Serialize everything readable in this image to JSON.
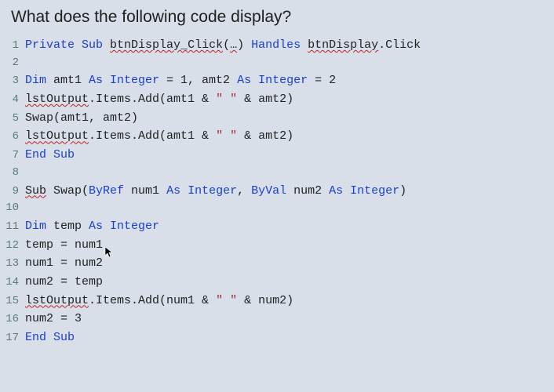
{
  "question": "What does the following code display?",
  "lines": {
    "l1": {
      "kw1": "Private Sub",
      "p1": " ",
      "sq1": "btnDisplay_Click",
      "p2": "(",
      "sq2": "…",
      "p3": ") ",
      "kw2": "Handles",
      "p4": " ",
      "sq3": "btnDisplay",
      "p5": ".Click"
    },
    "l3": {
      "kw1": "Dim",
      "p1": " amt1 ",
      "kw2": "As Integer",
      "p2": " = 1, amt2 ",
      "kw3": "As Integer",
      "p3": " = 2"
    },
    "l4": {
      "sq1": "lstOutput",
      "p1": ".Items.Add(amt1 ",
      "amp1": "&",
      "p2": " ",
      "str1": "\" \"",
      "p3": " ",
      "amp2": "&",
      "p4": " amt2)"
    },
    "l5": {
      "p1": "Swap(amt1, amt2)"
    },
    "l6": {
      "sq1": "lstOutput",
      "p1": ".Items.Add(amt1 ",
      "amp1": "&",
      "p2": " ",
      "str1": "\" \"",
      "p3": " ",
      "amp2": "&",
      "p4": " amt2)"
    },
    "l7": {
      "kw1": "End Sub"
    },
    "l9": {
      "sq1": "Sub",
      "p1": " Swap(",
      "kw1": "ByRef",
      "p2": " num1 ",
      "kw2": "As Integer",
      "p3": ", ",
      "kw3": "ByVal",
      "p4": " num2 ",
      "kw4": "As Integer",
      "p5": ")"
    },
    "l11": {
      "kw1": "Dim",
      "p1": " temp ",
      "kw2": "As Integer"
    },
    "l12": {
      "p1": "temp = num1"
    },
    "l13": {
      "p1": "num1 = num2"
    },
    "l14": {
      "p1": "num2 = temp"
    },
    "l15": {
      "sq1": "lstOutput",
      "p1": ".Items.Add(num1 ",
      "amp1": "&",
      "p2": " ",
      "str1": "\" \"",
      "p3": " ",
      "amp2": "&",
      "p4": " num2)"
    },
    "l16": {
      "p1": "num2 = 3"
    },
    "l17": {
      "kw1": "End Sub"
    },
    "ln": {
      "n1": "1",
      "n2": "2",
      "n3": "3",
      "n4": "4",
      "n5": "5",
      "n6": "6",
      "n7": "7",
      "n8": "8",
      "n9": "9",
      "n10": "10",
      "n11": "11",
      "n12": "12",
      "n13": "13",
      "n14": "14",
      "n15": "15",
      "n16": "16",
      "n17": "17"
    }
  }
}
